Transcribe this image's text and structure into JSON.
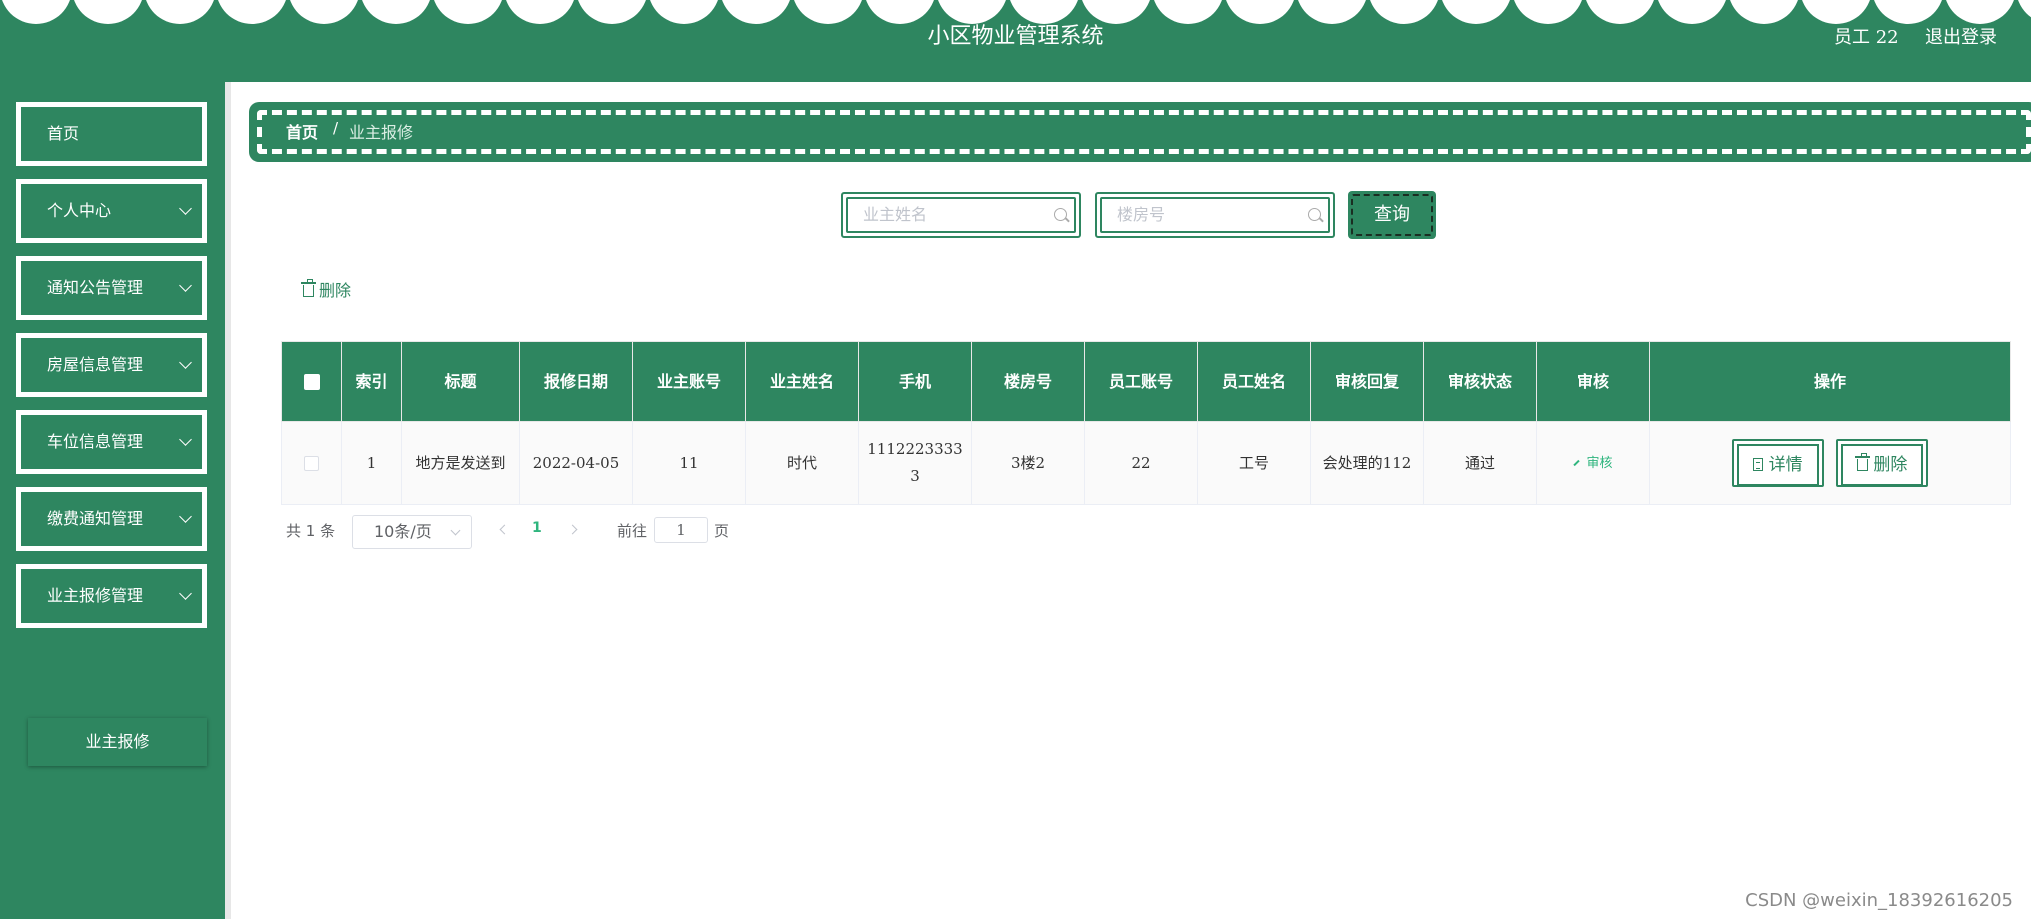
{
  "header": {
    "title": "小区物业管理系统",
    "user": "员工 22",
    "logout": "退出登录"
  },
  "sidebar": {
    "items": [
      {
        "label": "首页",
        "expandable": false
      },
      {
        "label": "个人中心",
        "expandable": true
      },
      {
        "label": "通知公告管理",
        "expandable": true
      },
      {
        "label": "房屋信息管理",
        "expandable": true
      },
      {
        "label": "车位信息管理",
        "expandable": true
      },
      {
        "label": "缴费通知管理",
        "expandable": true
      },
      {
        "label": "业主报修管理",
        "expandable": true
      }
    ],
    "active_sub": "业主报修"
  },
  "breadcrumb": {
    "home": "首页",
    "separator": "/",
    "current": "业主报修"
  },
  "search": {
    "owner_name_placeholder": "业主姓名",
    "building_placeholder": "楼房号",
    "query_label": "查询"
  },
  "toolbar": {
    "delete_label": "删除"
  },
  "table": {
    "columns": [
      "索引",
      "标题",
      "报修日期",
      "业主账号",
      "业主姓名",
      "手机",
      "楼房号",
      "员工账号",
      "员工姓名",
      "审核回复",
      "审核状态",
      "审核",
      "操作"
    ],
    "rows": [
      {
        "index": "1",
        "title": "地方是发送到",
        "date": "2022-04-05",
        "owner_account": "11",
        "owner_name": "时代",
        "phone": "11122233333",
        "building": "3楼2",
        "staff_account": "22",
        "staff_name": "工号",
        "reply": "会处理的112",
        "status": "通过",
        "audit_label": "审核",
        "detail_label": "详情",
        "delete_label": "删除"
      }
    ]
  },
  "pagination": {
    "total": "共 1 条",
    "page_size": "10条/页",
    "current_page": "1",
    "goto_prefix": "前往",
    "goto_value": "1",
    "goto_suffix": "页"
  },
  "watermark": "CSDN @weixin_18392616205",
  "colors": {
    "primary": "#2e8660",
    "link": "#2fb57e",
    "divider": "#e7e7e7"
  },
  "icons": [
    "search-icon",
    "trash-icon",
    "edit-icon",
    "document-icon",
    "chevron-down-icon",
    "chevron-left-icon",
    "chevron-right-icon"
  ]
}
